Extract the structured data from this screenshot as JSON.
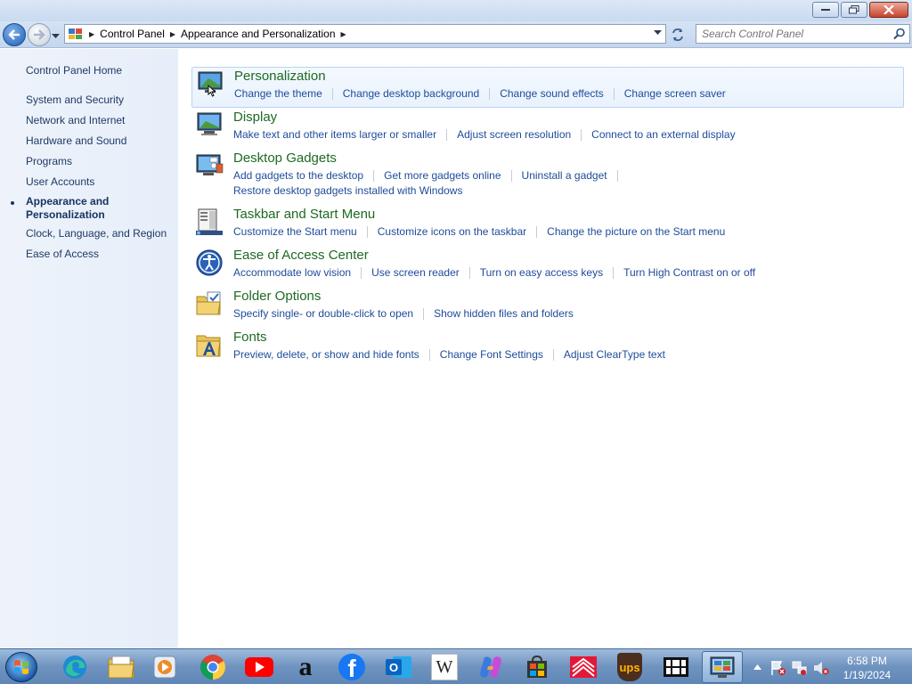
{
  "window": {
    "minimize_label": "minimize",
    "maximize_label": "maximize",
    "close_label": "close"
  },
  "address_bar": {
    "breadcrumbs": [
      "Control Panel",
      "Appearance and Personalization"
    ]
  },
  "search": {
    "placeholder": "Search Control Panel"
  },
  "sidebar": {
    "home": "Control Panel Home",
    "items": [
      "System and Security",
      "Network and Internet",
      "Hardware and Sound",
      "Programs",
      "User Accounts",
      "Appearance and Personalization",
      "Clock, Language, and Region",
      "Ease of Access"
    ],
    "current_line1": "Appearance and",
    "current_line2": "Personalization"
  },
  "categories": [
    {
      "title": "Personalization",
      "links": [
        "Change the theme",
        "Change desktop background",
        "Change sound effects",
        "Change screen saver"
      ]
    },
    {
      "title": "Display",
      "links": [
        "Make text and other items larger or smaller",
        "Adjust screen resolution",
        "Connect to an external display"
      ]
    },
    {
      "title": "Desktop Gadgets",
      "links": [
        "Add gadgets to the desktop",
        "Get more gadgets online",
        "Uninstall a gadget"
      ],
      "links2": [
        "Restore desktop gadgets installed with Windows"
      ]
    },
    {
      "title": "Taskbar and Start Menu",
      "links": [
        "Customize the Start menu",
        "Customize icons on the taskbar",
        "Change the picture on the Start menu"
      ]
    },
    {
      "title": "Ease of Access Center",
      "links": [
        "Accommodate low vision",
        "Use screen reader",
        "Turn on easy access keys",
        "Turn High Contrast on or off"
      ]
    },
    {
      "title": "Folder Options",
      "links": [
        "Specify single- or double-click to open",
        "Show hidden files and folders"
      ]
    },
    {
      "title": "Fonts",
      "links": [
        "Preview, delete, or show and hide fonts",
        "Change Font Settings",
        "Adjust ClearType text"
      ]
    }
  ],
  "taskbar": {
    "apps": [
      "edge-icon",
      "file-explorer-icon",
      "media-player-icon",
      "chrome-icon",
      "youtube-icon",
      "amazon-icon",
      "facebook-icon",
      "outlook-icon",
      "wikipedia-icon",
      "copilot-icon",
      "store-icon",
      "bank-of-america-icon",
      "ups-icon",
      "film-icon",
      "control-panel-icon"
    ],
    "wikipedia_letter": "W",
    "ups_text": "ups",
    "amazon_letter": "a",
    "facebook_letter": "f",
    "outlook_letter": "O",
    "time": "6:58 PM",
    "date": "1/19/2024"
  },
  "colors": {
    "link": "#1e4b9a",
    "category_title": "#1d6a22",
    "sidebar_link": "#1e3a66"
  }
}
